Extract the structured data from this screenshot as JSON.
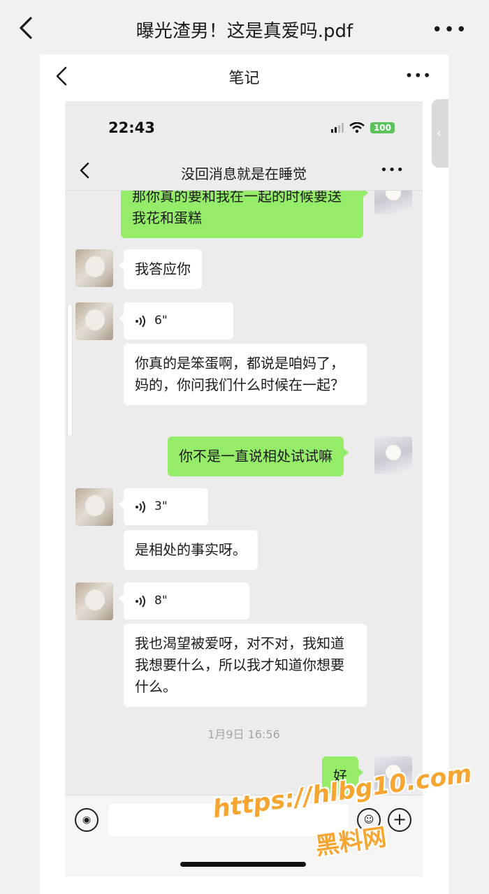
{
  "viewer": {
    "title": "曝光渣男！这是真爱吗.pdf",
    "more": "•••"
  },
  "notes": {
    "title": "笔记",
    "more": "•••",
    "side_arrow": "‹"
  },
  "phone": {
    "time": "22:43",
    "battery": "100",
    "chat_title": "没回消息就是在睡觉",
    "chat_more": "•••"
  },
  "messages": [
    {
      "side": "out",
      "text": "那你真的要和我在一起的时候要送我花和蛋糕"
    },
    {
      "side": "in",
      "text": "我答应你"
    },
    {
      "side": "in",
      "type": "voice",
      "duration": "6\""
    },
    {
      "side": "in",
      "text": "你真的是笨蛋啊，都说是咱妈了，妈的，你问我们什么时候在一起？"
    },
    {
      "side": "out",
      "text": "你不是一直说相处试试嘛"
    },
    {
      "side": "in",
      "type": "voice",
      "duration": "3\""
    },
    {
      "side": "in",
      "text": "是相处的事实呀。"
    },
    {
      "side": "in",
      "type": "voice",
      "duration": "8\""
    },
    {
      "side": "in",
      "text": "我也渴望被爱呀，对不对，我知道我想要什么，所以我才知道你想要什么。"
    },
    {
      "side": "out",
      "text": "好"
    }
  ],
  "timestamp": "1月9日 16:56",
  "watermark": {
    "url": "https://hlbg10.com",
    "name": "黑料网"
  },
  "colors": {
    "outgoing_bubble": "#95ec69",
    "incoming_bubble": "#ffffff",
    "watermark": "#f7a531"
  },
  "icons": [
    "back-arrow-icon",
    "more-dots-icon",
    "signal-icon",
    "wifi-icon",
    "battery-icon",
    "voice-wave-icon",
    "emoji-icon",
    "plus-icon"
  ]
}
